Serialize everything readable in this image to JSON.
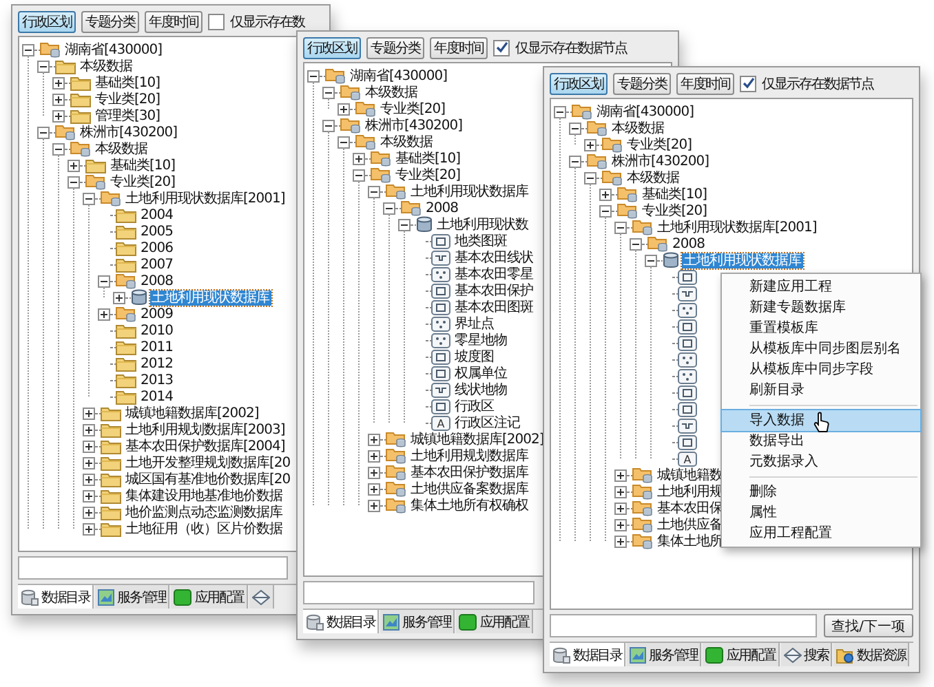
{
  "windows": [
    {
      "toolbar": {
        "buttons": [
          {
            "label": "行政区划",
            "selected": true
          },
          {
            "label": "专题分类",
            "selected": false
          },
          {
            "label": "年度时间",
            "selected": false
          }
        ],
        "checkbox": {
          "label": "仅显示存在数",
          "checked": false
        }
      },
      "tree": [
        {
          "label": "湖南省[430000]",
          "kind": "folder-db",
          "expanded": true,
          "selected": false,
          "children": [
            {
              "label": "本级数据",
              "kind": "folder",
              "expanded": true,
              "selected": false,
              "children": [
                {
                  "label": "基础类[10]",
                  "kind": "folder",
                  "expanded": false,
                  "selected": false
                },
                {
                  "label": "专业类[20]",
                  "kind": "folder",
                  "expanded": false,
                  "selected": false
                },
                {
                  "label": "管理类[30]",
                  "kind": "folder",
                  "expanded": false,
                  "selected": false
                }
              ]
            },
            {
              "label": "株洲市[430200]",
              "kind": "folder-db",
              "expanded": true,
              "selected": false,
              "children": [
                {
                  "label": "本级数据",
                  "kind": "folder-db",
                  "expanded": true,
                  "selected": false,
                  "children": [
                    {
                      "label": "基础类[10]",
                      "kind": "folder",
                      "expanded": false,
                      "selected": false
                    },
                    {
                      "label": "专业类[20]",
                      "kind": "folder-db",
                      "expanded": true,
                      "selected": false,
                      "children": [
                        {
                          "label": "土地利用现状数据库[2001]",
                          "kind": "folder-db",
                          "expanded": true,
                          "selected": false,
                          "children": [
                            {
                              "label": "2004",
                              "kind": "folder",
                              "selected": false
                            },
                            {
                              "label": "2005",
                              "kind": "folder",
                              "selected": false
                            },
                            {
                              "label": "2006",
                              "kind": "folder",
                              "selected": false
                            },
                            {
                              "label": "2007",
                              "kind": "folder",
                              "selected": false
                            },
                            {
                              "label": "2008",
                              "kind": "folder-db",
                              "expanded": true,
                              "selected": false,
                              "children": [
                                {
                                  "label": "土地利用现状数据库",
                                  "kind": "database",
                                  "expanded": false,
                                  "selected": true
                                }
                              ]
                            },
                            {
                              "label": "2009",
                              "kind": "folder-db",
                              "expanded": false,
                              "selected": false
                            },
                            {
                              "label": "2010",
                              "kind": "folder",
                              "selected": false
                            },
                            {
                              "label": "2011",
                              "kind": "folder",
                              "selected": false
                            },
                            {
                              "label": "2012",
                              "kind": "folder",
                              "selected": false
                            },
                            {
                              "label": "2013",
                              "kind": "folder",
                              "selected": false
                            },
                            {
                              "label": "2014",
                              "kind": "folder",
                              "selected": false
                            }
                          ]
                        },
                        {
                          "label": "城镇地籍数据库[2002]",
                          "kind": "folder",
                          "expanded": false,
                          "selected": false
                        },
                        {
                          "label": "土地利用规划数据库[2003]",
                          "kind": "folder",
                          "expanded": false,
                          "selected": false
                        },
                        {
                          "label": "基本农田保护数据库[2004]",
                          "kind": "folder",
                          "expanded": false,
                          "selected": false
                        },
                        {
                          "label": "土地开发整理规划数据库[20",
                          "kind": "folder",
                          "expanded": false,
                          "selected": false
                        },
                        {
                          "label": "城区国有基准地价数据库[20",
                          "kind": "folder",
                          "expanded": false,
                          "selected": false
                        },
                        {
                          "label": "集体建设用地基准地价数据",
                          "kind": "folder",
                          "expanded": false,
                          "selected": false
                        },
                        {
                          "label": "地价监测点动态监测数据库",
                          "kind": "folder",
                          "expanded": false,
                          "selected": false
                        },
                        {
                          "label": "土地征用（收）区片价数据",
                          "kind": "folder",
                          "expanded": false,
                          "selected": false
                        }
                      ]
                    }
                  ]
                }
              ]
            }
          ]
        }
      ],
      "tabs": [
        {
          "label": "数据目录",
          "kind": "catalog",
          "selected": true
        },
        {
          "label": "服务管理",
          "kind": "service",
          "selected": false
        },
        {
          "label": "应用配置",
          "kind": "config",
          "selected": false
        },
        {
          "kind": "search",
          "selected": false
        }
      ]
    },
    {
      "toolbar": {
        "buttons": [
          {
            "label": "行政区划",
            "selected": true
          },
          {
            "label": "专题分类",
            "selected": false
          },
          {
            "label": "年度时间",
            "selected": false
          }
        ],
        "checkbox": {
          "label": "仅显示存在数据节点",
          "checked": true
        }
      },
      "tree": [
        {
          "label": "湖南省[430000]",
          "kind": "folder-db",
          "expanded": true,
          "selected": false,
          "children": [
            {
              "label": "本级数据",
              "kind": "folder-db",
              "expanded": true,
              "selected": false,
              "children": [
                {
                  "label": "专业类[20]",
                  "kind": "folder-db",
                  "expanded": false,
                  "selected": false
                }
              ]
            },
            {
              "label": "株洲市[430200]",
              "kind": "folder-db",
              "expanded": true,
              "selected": false,
              "children": [
                {
                  "label": "本级数据",
                  "kind": "folder-db",
                  "expanded": true,
                  "selected": false,
                  "children": [
                    {
                      "label": "基础类[10]",
                      "kind": "folder-db",
                      "expanded": false,
                      "selected": false
                    },
                    {
                      "label": "专业类[20]",
                      "kind": "folder-db",
                      "expanded": true,
                      "selected": false,
                      "children": [
                        {
                          "label": "土地利用现状数据库",
                          "kind": "folder-db",
                          "expanded": true,
                          "selected": false,
                          "children": [
                            {
                              "label": "2008",
                              "kind": "folder-db",
                              "expanded": true,
                              "selected": false,
                              "children": [
                                {
                                  "label": "土地利用现状数",
                                  "kind": "database",
                                  "expanded": true,
                                  "selected": false,
                                  "children": [
                                    {
                                      "label": "地类图斑",
                                      "kind": "polygon",
                                      "selected": false
                                    },
                                    {
                                      "label": "基本农田线状",
                                      "kind": "line",
                                      "selected": false
                                    },
                                    {
                                      "label": "基本农田零星",
                                      "kind": "point",
                                      "selected": false
                                    },
                                    {
                                      "label": "基本农田保护",
                                      "kind": "polygon",
                                      "selected": false
                                    },
                                    {
                                      "label": "基本农田图斑",
                                      "kind": "polygon",
                                      "selected": false
                                    },
                                    {
                                      "label": "界址点",
                                      "kind": "point",
                                      "selected": false
                                    },
                                    {
                                      "label": "零星地物",
                                      "kind": "point",
                                      "selected": false
                                    },
                                    {
                                      "label": "坡度图",
                                      "kind": "polygon",
                                      "selected": false
                                    },
                                    {
                                      "label": "权属单位",
                                      "kind": "polygon",
                                      "selected": false
                                    },
                                    {
                                      "label": "线状地物",
                                      "kind": "line",
                                      "selected": false
                                    },
                                    {
                                      "label": "行政区",
                                      "kind": "polygon",
                                      "selected": false
                                    },
                                    {
                                      "label": "行政区注记",
                                      "kind": "annotation",
                                      "icon_label": "A",
                                      "selected": false
                                    }
                                  ]
                                }
                              ]
                            }
                          ]
                        },
                        {
                          "label": "城镇地籍数据库[2002]",
                          "kind": "folder-db",
                          "expanded": false,
                          "selected": false
                        },
                        {
                          "label": "土地利用规划数据库",
                          "kind": "folder-db",
                          "expanded": false,
                          "selected": false
                        },
                        {
                          "label": "基本农田保护数据库",
                          "kind": "folder-db",
                          "expanded": false,
                          "selected": false
                        },
                        {
                          "label": "土地供应备案数据库",
                          "kind": "folder-db",
                          "expanded": false,
                          "selected": false
                        },
                        {
                          "label": "集体土地所有权确权",
                          "kind": "folder-db",
                          "expanded": false,
                          "selected": false
                        }
                      ]
                    }
                  ]
                }
              ]
            }
          ]
        }
      ],
      "tabs": [
        {
          "label": "数据目录",
          "kind": "catalog",
          "selected": true
        },
        {
          "label": "服务管理",
          "kind": "service",
          "selected": false
        },
        {
          "label": "应用配置",
          "kind": "config",
          "selected": false
        }
      ]
    },
    {
      "toolbar": {
        "buttons": [
          {
            "label": "行政区划",
            "selected": true
          },
          {
            "label": "专题分类",
            "selected": false
          },
          {
            "label": "年度时间",
            "selected": false
          }
        ],
        "checkbox": {
          "label": "仅显示存在数据节点",
          "checked": true
        }
      },
      "tree": [
        {
          "label": "湖南省[430000]",
          "kind": "folder-db",
          "expanded": true,
          "selected": false,
          "children": [
            {
              "label": "本级数据",
              "kind": "folder-db",
              "expanded": true,
              "selected": false,
              "children": [
                {
                  "label": "专业类[20]",
                  "kind": "folder-db",
                  "expanded": false,
                  "selected": false
                }
              ]
            },
            {
              "label": "株洲市[430200]",
              "kind": "folder-db",
              "expanded": true,
              "selected": false,
              "children": [
                {
                  "label": "本级数据",
                  "kind": "folder-db",
                  "expanded": true,
                  "selected": false,
                  "children": [
                    {
                      "label": "基础类[10]",
                      "kind": "folder-db",
                      "expanded": false,
                      "selected": false
                    },
                    {
                      "label": "专业类[20]",
                      "kind": "folder-db",
                      "expanded": true,
                      "selected": false,
                      "children": [
                        {
                          "label": "土地利用现状数据库[2001]",
                          "kind": "folder-db",
                          "expanded": true,
                          "selected": false,
                          "children": [
                            {
                              "label": "2008",
                              "kind": "folder-db",
                              "expanded": true,
                              "selected": false,
                              "children": [
                                {
                                  "label": "土地利用现状数据库",
                                  "kind": "database",
                                  "expanded": true,
                                  "selected": true,
                                  "children": [
                                    {
                                      "kind": "polygon"
                                    },
                                    {
                                      "kind": "line"
                                    },
                                    {
                                      "kind": "point"
                                    },
                                    {
                                      "kind": "polygon"
                                    },
                                    {
                                      "kind": "polygon"
                                    },
                                    {
                                      "kind": "point"
                                    },
                                    {
                                      "kind": "point"
                                    },
                                    {
                                      "kind": "polygon"
                                    },
                                    {
                                      "kind": "polygon"
                                    },
                                    {
                                      "kind": "line"
                                    },
                                    {
                                      "kind": "polygon"
                                    },
                                    {
                                      "kind": "annotation",
                                      "icon_label": "A"
                                    }
                                  ]
                                }
                              ]
                            }
                          ]
                        },
                        {
                          "label": "城镇地籍数",
                          "kind": "folder-db",
                          "expanded": false,
                          "selected": false
                        },
                        {
                          "label": "土地利用规",
                          "kind": "folder-db",
                          "expanded": false,
                          "selected": false
                        },
                        {
                          "label": "基本农田保",
                          "kind": "folder-db",
                          "expanded": false,
                          "selected": false
                        },
                        {
                          "label": "土地供应备",
                          "kind": "folder-db",
                          "expanded": false,
                          "selected": false
                        },
                        {
                          "label": "集体土地所",
                          "kind": "folder-db",
                          "expanded": false,
                          "selected": false
                        }
                      ]
                    }
                  ]
                }
              ]
            }
          ]
        }
      ],
      "search_button": "查找/下一项",
      "context_menu": {
        "groups": [
          [
            {
              "label": "新建应用工程",
              "selected": false
            },
            {
              "label": "新建专题数据库",
              "selected": false
            },
            {
              "label": "重置模板库",
              "selected": false
            },
            {
              "label": "从模板库中同步图层别名",
              "selected": false
            },
            {
              "label": "从模板库中同步字段",
              "selected": false
            },
            {
              "label": "刷新目录",
              "selected": false
            }
          ],
          [
            {
              "label": "导入数据",
              "selected": true
            },
            {
              "label": "数据导出",
              "selected": false
            },
            {
              "label": "元数据录入",
              "selected": false
            }
          ],
          [
            {
              "label": "删除",
              "selected": false
            },
            {
              "label": "属性",
              "selected": false
            },
            {
              "label": "应用工程配置",
              "selected": false
            }
          ]
        ]
      },
      "tabs": [
        {
          "label": "数据目录",
          "kind": "catalog",
          "selected": true
        },
        {
          "label": "服务管理",
          "kind": "service",
          "selected": false
        },
        {
          "label": "应用配置",
          "kind": "config",
          "selected": false
        },
        {
          "label": "搜索",
          "kind": "search",
          "selected": false
        },
        {
          "label": "数据资源",
          "kind": "resource",
          "selected": false
        }
      ]
    }
  ]
}
